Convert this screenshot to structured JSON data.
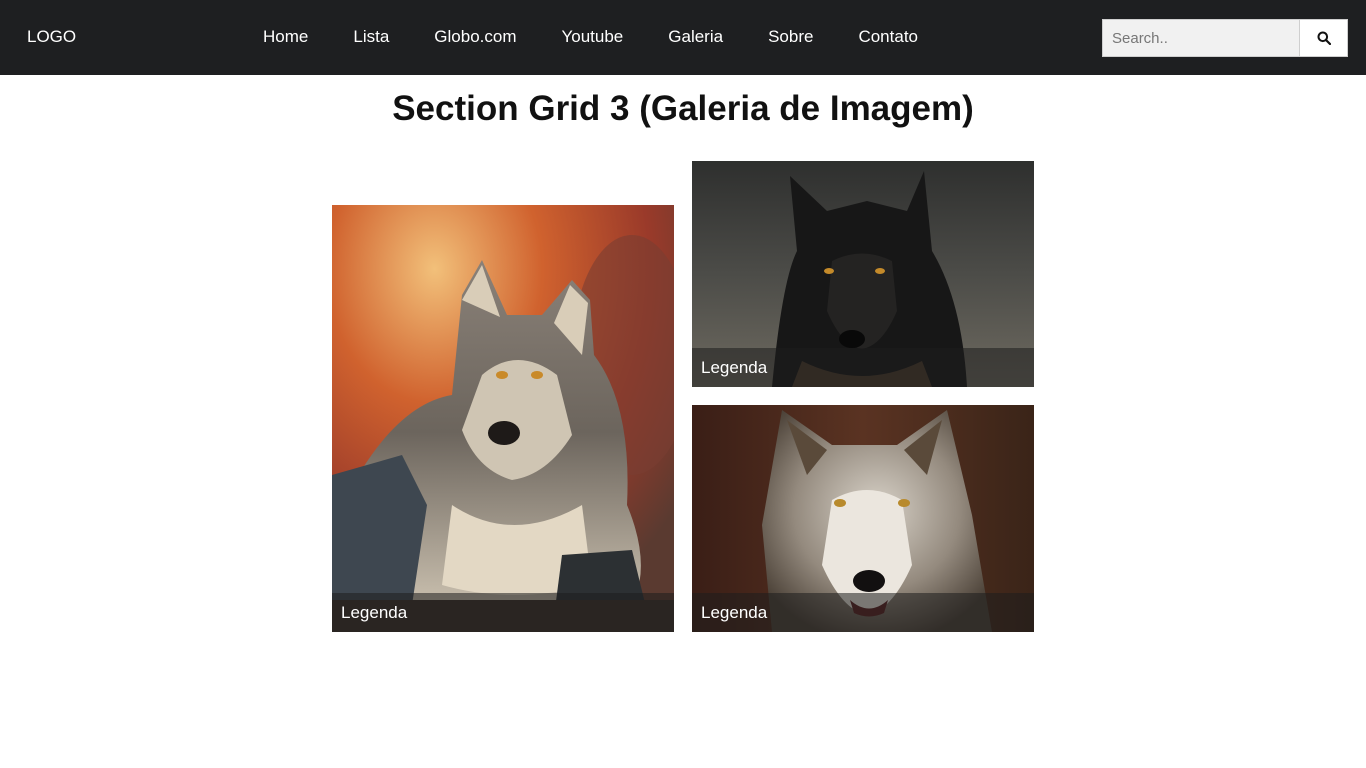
{
  "nav": {
    "logo": "LOGO",
    "items": [
      {
        "label": "Home"
      },
      {
        "label": "Lista"
      },
      {
        "label": "Globo.com"
      },
      {
        "label": "Youtube"
      },
      {
        "label": "Galeria"
      },
      {
        "label": "Sobre"
      },
      {
        "label": "Contato"
      }
    ],
    "search_placeholder": "Search..",
    "search_icon": "search-icon"
  },
  "main": {
    "title": "Section Grid 3 (Galeria de Imagem)",
    "gallery": [
      {
        "caption": "Legenda",
        "image": "gray-wolf-autumn-photo"
      },
      {
        "caption": "Legenda",
        "image": "black-wolf-photo"
      },
      {
        "caption": "Legenda",
        "image": "gray-wolf-closeup-photo"
      }
    ]
  },
  "colors": {
    "nav_background": "#1e1f21",
    "caption_overlay": "rgba(30,30,30,0.55)",
    "text_primary": "#111111"
  }
}
